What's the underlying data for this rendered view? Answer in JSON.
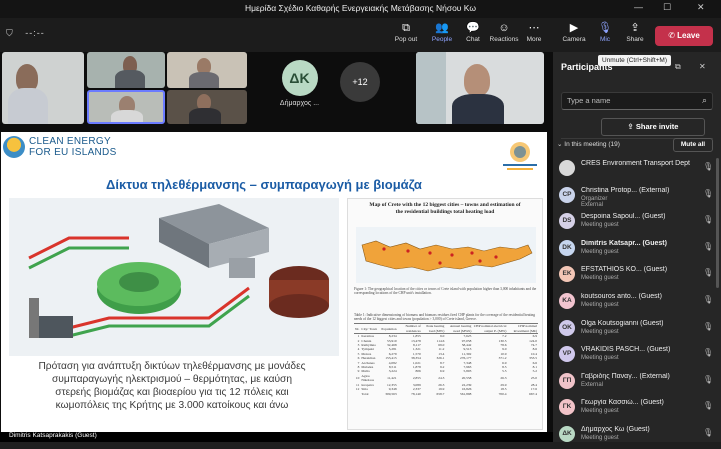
{
  "window": {
    "title": "Ημερίδα Σχέδιο Καθαρής Ενεργειακής Μετάβασης Νήσου Κω"
  },
  "toolbar": {
    "timer": "--:--",
    "popout": "Pop out",
    "people": "People",
    "chat": "Chat",
    "reactions": "Reactions",
    "more": "More",
    "camera": "Camera",
    "mic": "Mic",
    "share": "Share",
    "leave": "Leave",
    "tooltip": "Unmute (Ctrl+Shift+M)"
  },
  "stage": {
    "avatar_initials": "ΔΚ",
    "avatar_name": "Δήμαρχος ...",
    "more_count": "+12",
    "speaker_name": "Dimitris Katsaprakakis (Guest)"
  },
  "slide": {
    "logo_line1": "CLEAN ENERGY",
    "logo_line2": "FOR EU ISLANDS",
    "title": "Δίκτυα τηλεθέρμανσης – συμπαραγωγή με βιομάζα",
    "paper_title": "Map of Crete with the 12 biggest cities – towns and estimation of the residential buildings total heating load",
    "figure_caption": "Figure 1: The geographical location of the cities or towns of Crete island with population higher than 3,000 inhabitants and the corresponding locations of the CHP unit's installation.",
    "table_caption": "Table 1: Indicative dimensioning of biomass and biomass residues fired CHP plants for the coverage of the residential heating needs of the 12 biggest cities and towns (population > 3,000) of Crete island, Greece.",
    "table_headers": [
      "Nr.",
      "City/ Town",
      "Population",
      "Number of residences",
      "Peak heating load (MW)",
      "Annual heating need (MWh)",
      "CHP nominal electrical output Pₑ (MW)",
      "CHP nominal investment (M€)"
    ],
    "table_rows": [
      [
        "1",
        "Keramos",
        "8,234",
        "1,855",
        "9.0",
        "7,625",
        "7.2",
        "6.9"
      ],
      [
        "2",
        "Chania",
        "53,910",
        "13,478",
        "114.6",
        "97,058",
        "130.5",
        "124.0"
      ],
      [
        "3",
        "Rethymno",
        "32,468",
        "8,117",
        "69.0",
        "58,442",
        "78.6",
        "74.7"
      ],
      [
        "4",
        "Tympaki",
        "5,281",
        "1,321",
        "11.2",
        "9,513",
        "9.0",
        "8.6"
      ],
      [
        "5",
        "Moires",
        "6,279",
        "1,570",
        "13.4",
        "11,302",
        "10.9",
        "10.4"
      ],
      [
        "6",
        "Heraklion",
        "153,415",
        "38,354",
        "326.1",
        "276,177",
        "371.2",
        "353.5"
      ],
      [
        "7",
        "Archanes",
        "4,082",
        "1,021",
        "8.7",
        "7,348",
        "6.9",
        "6.6"
      ],
      [
        "8",
        "Malades",
        "8,511",
        "1,878",
        "9.2",
        "7,963",
        "8.5",
        "8.1"
      ],
      [
        "9",
        "Malia",
        "3,224",
        "806",
        "6.9",
        "5,803",
        "5.5",
        "5.2"
      ],
      [
        "10",
        "Agios Nikolaos",
        "11,421",
        "2,855",
        "24.3",
        "20,558",
        "26.3",
        "25.0"
      ],
      [
        "11",
        "Ierapetra",
        "12,355",
        "3,089",
        "26.3",
        "22,239",
        "29.9",
        "28.4"
      ],
      [
        "12",
        "Sitia",
        "9,348",
        "2,337",
        "19.9",
        "16,826",
        "18.5",
        "17.6"
      ],
      [
        "",
        "Total",
        "309,563",
        "78,140",
        "658.7",
        "561,898",
        "700.4",
        "667.4"
      ]
    ],
    "caption_lines": [
      "Πρόταση για ανάπτυξη δικτύων τηλεθέρμανσης με μονάδες",
      "συμπαραγωγής ηλεκτρισμού – θερμότητας, με καύση",
      "στερεής βιομάζας και βιοαερίου για τις 12 πόλεις και",
      "κωμοπόλεις της Κρήτης με 3.000 κατοίκους και άνω"
    ]
  },
  "panel": {
    "title": "Participants",
    "search_placeholder": "Type a name",
    "share_invite": "Share invite",
    "in_meeting": "In this meeting (19)",
    "mute_all": "Mute all",
    "participants": [
      {
        "initials": "",
        "name": "CRES Environment Transport Dept",
        "sub": "",
        "color": "#d8d8d8",
        "bold": false
      },
      {
        "initials": "CP",
        "name": "Christina Protop... (External)",
        "sub": "Organizer",
        "sub2": "External",
        "color": "#c9d3ea",
        "bold": false
      },
      {
        "initials": "DS",
        "name": "Despoina Sapoul... (Guest)",
        "sub": "Meeting guest",
        "color": "#d5d0e6",
        "bold": false
      },
      {
        "initials": "DK",
        "name": "Dimitris Katsapr... (Guest)",
        "sub": "Meeting guest",
        "color": "#c6d6ef",
        "bold": true
      },
      {
        "initials": "EK",
        "name": "EFSTATHIOS KO... (Guest)",
        "sub": "Meeting guest",
        "color": "#f3c6b6",
        "bold": false
      },
      {
        "initials": "KA",
        "name": "koutsouros anto... (Guest)",
        "sub": "Meeting guest",
        "color": "#f2c4cf",
        "bold": false
      },
      {
        "initials": "OK",
        "name": "Olga Koutsogianni (Guest)",
        "sub": "Meeting guest",
        "color": "#cfc9ea",
        "bold": false
      },
      {
        "initials": "VP",
        "name": "VRAKIDIS PASCH... (Guest)",
        "sub": "Meeting guest",
        "color": "#d0c8ec",
        "bold": false
      },
      {
        "initials": "ΓΠ",
        "name": "Γαβριδης Παναγ... (External)",
        "sub": "External",
        "color": "#f0c3c9",
        "bold": false
      },
      {
        "initials": "ΓΚ",
        "name": "Γεωργία Κασσιώ... (Guest)",
        "sub": "Meeting guest",
        "color": "#f2c3c8",
        "bold": false
      },
      {
        "initials": "ΔΚ",
        "name": "Δήμαρχος Κω (Guest)",
        "sub": "Meeting guest",
        "color": "#b9d9c4",
        "bold": false
      }
    ]
  },
  "colors": {
    "leave": "#c4314b",
    "accent": "#8fa4ff",
    "slide_title": "#1b5ca5",
    "crete": "#f0a33a"
  },
  "icons": [
    "shield-icon",
    "popout-icon",
    "people-icon",
    "chat-icon",
    "reactions-icon",
    "more-icon",
    "camera-icon",
    "mic-off-icon",
    "share-icon",
    "phone-icon",
    "pin-icon",
    "close-icon",
    "search-icon",
    "share-invite-icon",
    "chevron-down-icon",
    "mic-muted-icon"
  ]
}
